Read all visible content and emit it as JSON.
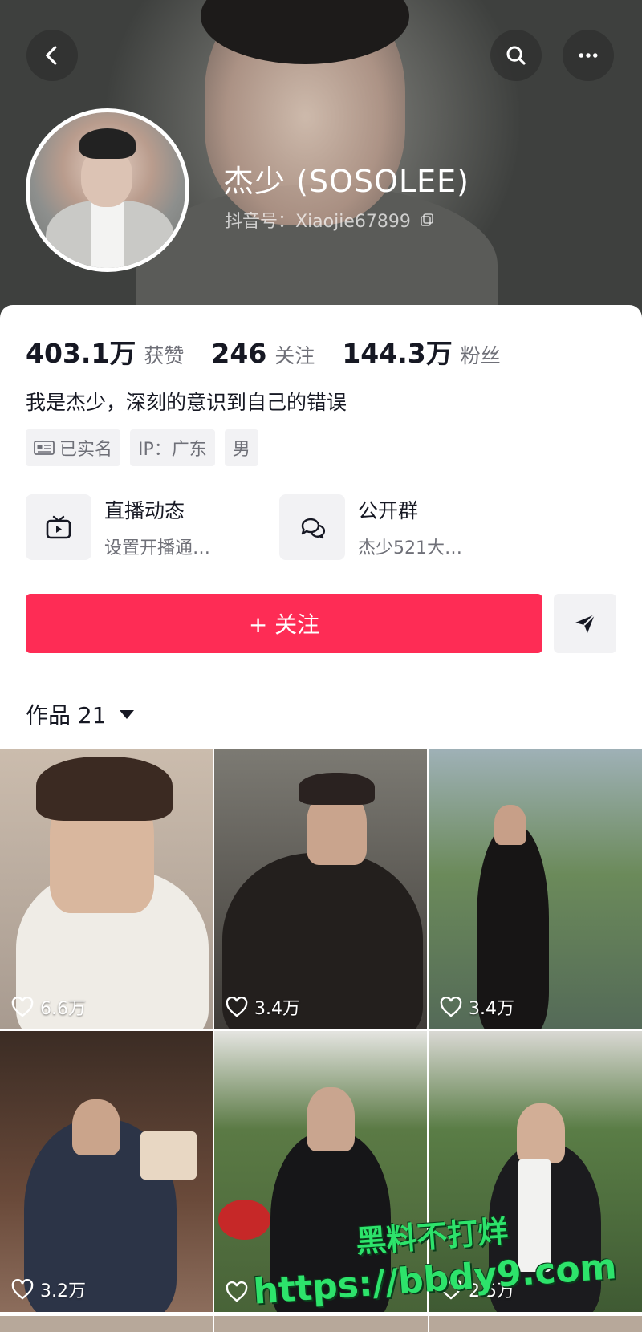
{
  "header": {
    "display_name": "杰少 (SOSOLEE)",
    "douyin_id": "抖音号：Xiaojie67899"
  },
  "stats": [
    {
      "value": "403.1万",
      "label": "获赞"
    },
    {
      "value": "246",
      "label": "关注"
    },
    {
      "value": "144.3万",
      "label": "粉丝"
    }
  ],
  "bio": "我是杰少，深刻的意识到自己的错误",
  "tags": {
    "verified": "已实名",
    "ip": "IP：广东",
    "gender": "男"
  },
  "features": {
    "live": {
      "title": "直播动态",
      "subtitle": "设置开播通…"
    },
    "group": {
      "title": "公开群",
      "subtitle": "杰少521大…"
    }
  },
  "actions": {
    "follow_label": "+ 关注"
  },
  "works": {
    "label": "作品 21"
  },
  "grid": [
    {
      "likes": "6.6万"
    },
    {
      "likes": "3.4万"
    },
    {
      "likes": "3.4万"
    },
    {
      "likes": "3.2万"
    },
    {
      "likes": ""
    },
    {
      "likes": "2.5万"
    }
  ],
  "watermark": {
    "line1": "黑料不打烊",
    "line2": "https://bbdy9.com"
  },
  "colors": {
    "accent": "#fe2c55",
    "watermark": "#2de36b"
  },
  "icons": [
    "back-icon",
    "search-icon",
    "more-icon",
    "copy-icon",
    "id-card-icon",
    "tv-icon",
    "chat-bubbles-icon",
    "send-icon",
    "heart-icon"
  ]
}
